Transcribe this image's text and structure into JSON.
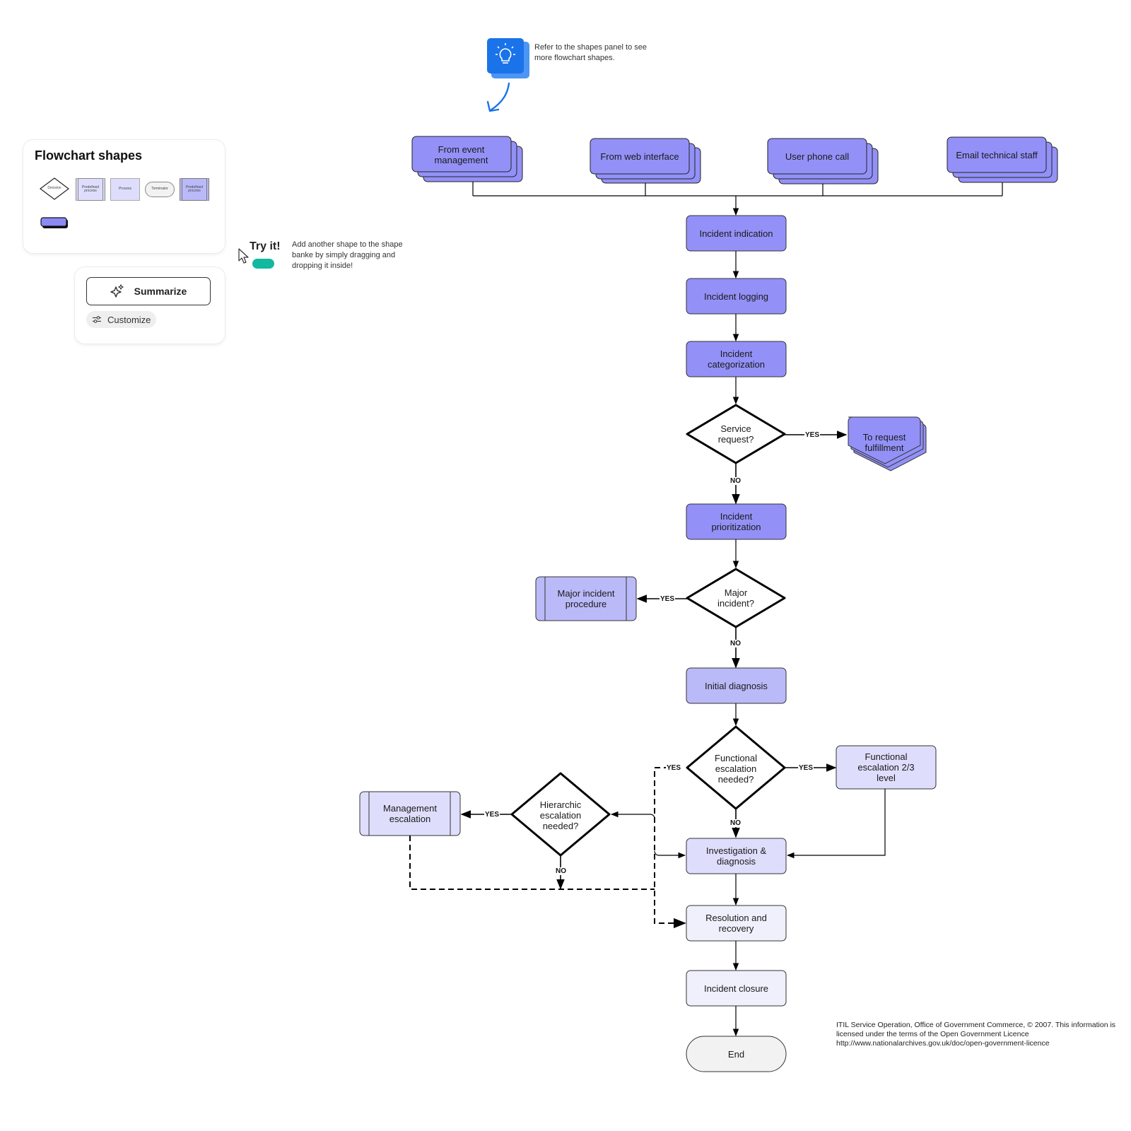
{
  "shapes_panel": {
    "title": "Flowchart shapes",
    "samples": [
      {
        "kind": "decision",
        "label": "Decision"
      },
      {
        "kind": "predefined-process-light",
        "label": "Predefined process"
      },
      {
        "kind": "process",
        "label": "Process"
      },
      {
        "kind": "terminator",
        "label": "Terminator"
      },
      {
        "kind": "predefined-process-dark",
        "label": "Predefined process"
      },
      {
        "kind": "multi-document",
        "label": ""
      }
    ]
  },
  "ai_panel": {
    "summarize_label": "Summarize",
    "customize_label": "Customize"
  },
  "try_it": {
    "heading": "Try it!",
    "text_lines": [
      "Add another shape to the shape",
      "banke by simply dragging and",
      "dropping it inside!"
    ]
  },
  "tip": {
    "icon": "lightbulb-icon",
    "text_lines": [
      "Refer to the shapes panel to see",
      "more flowchart shapes."
    ]
  },
  "colors": {
    "dark_fill": "#9391f7",
    "mid_fill": "#bbbaf8",
    "light_fill": "#dedefc",
    "lightest_fill": "#f0f0fc",
    "terminator_fill": "#f2f2f2",
    "tip_blue": "#1a73e8",
    "toggle_green": "#12b8a0"
  },
  "flowchart": {
    "sources": [
      {
        "id": "src-event",
        "label": "From event management"
      },
      {
        "id": "src-web",
        "label": "From web interface"
      },
      {
        "id": "src-phone",
        "label": "User phone call"
      },
      {
        "id": "src-email",
        "label": "Email technical staff"
      }
    ],
    "nodes": {
      "indication": "Incident indication",
      "logging": "Incident logging",
      "categorization": "Incident categorization",
      "service_request": "Service request?",
      "request_fulfillment": "To request fulfillment",
      "prioritization": "Incident prioritization",
      "major_incident": "Major incident?",
      "major_procedure": "Major incident procedure",
      "initial_diagnosis": "Initial diagnosis",
      "functional_escalation_q": "Functional escalation needed?",
      "functional_escalation": "Functional escalation 2/3 level",
      "hierarchic_escalation_q": "Hierarchic escalation needed?",
      "management_escalation": "Management escalation",
      "investigation": "Investigation & diagnosis",
      "resolution": "Resolution and recovery",
      "closure": "Incident closure",
      "end": "End"
    },
    "edge_labels": {
      "yes": "YES",
      "no": "NO"
    }
  },
  "credit": "ITIL Service Operation, Office of Government Commerce, © 2007. This information is licensed under the terms of the Open Government Licence http://www.nationalarchives.gov.uk/doc/open-government-licence"
}
